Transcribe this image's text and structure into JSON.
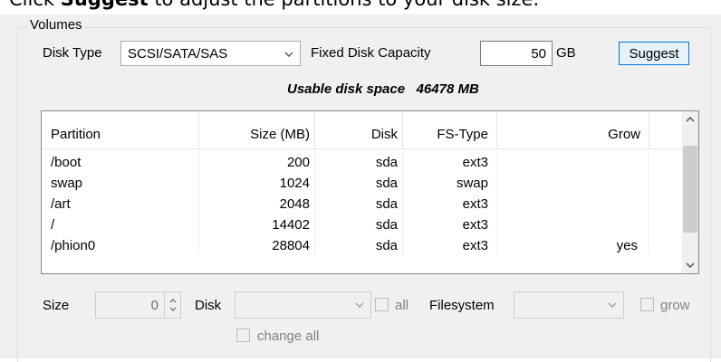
{
  "instruction": {
    "prefix": "Click ",
    "bold": "Suggest",
    "suffix": " to adjust the partitions to your disk size."
  },
  "volumes": {
    "legend": "Volumes",
    "disk_type_label": "Disk Type",
    "disk_type_value": "SCSI/SATA/SAS",
    "fixed_capacity_label": "Fixed Disk Capacity",
    "capacity_value": "50",
    "capacity_unit": "GB",
    "suggest_label": "Suggest",
    "usable_label": "Usable disk space",
    "usable_value": "46478 MB"
  },
  "table": {
    "columns": [
      "Partition",
      "Size (MB)",
      "Disk",
      "FS-Type",
      "Grow"
    ],
    "rows": [
      [
        "/boot",
        "200",
        "sda",
        "ext3",
        ""
      ],
      [
        "swap",
        "1024",
        "sda",
        "swap",
        ""
      ],
      [
        "/art",
        "2048",
        "sda",
        "ext3",
        ""
      ],
      [
        "/",
        "14402",
        "sda",
        "ext3",
        ""
      ],
      [
        "/phion0",
        "28804",
        "sda",
        "ext3",
        "yes"
      ]
    ],
    "scrollbar": {
      "up_icon": "chevron-up-icon",
      "down_icon": "chevron-down-icon"
    }
  },
  "editor": {
    "size_label": "Size",
    "size_value": "0",
    "disk_label": "Disk",
    "all_label": "all",
    "filesystem_label": "Filesystem",
    "grow_label": "grow",
    "change_all_label": "change all"
  },
  "colors": {
    "accent_border": "#0078d7",
    "button_bg": "#e5f1fb",
    "panel_bg": "#f0f0f0",
    "disabled_text": "#838383"
  }
}
